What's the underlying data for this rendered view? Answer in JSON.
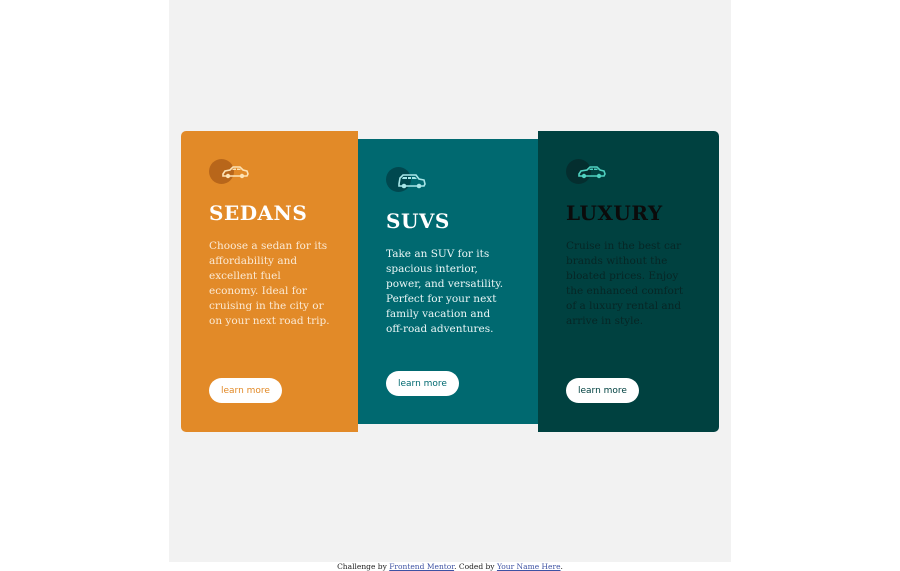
{
  "cards": [
    {
      "title": "SEDANS",
      "text": "Choose a sedan for its affordability and excellent fuel economy. Ideal for cruising in the city or on your next road trip.",
      "button": "learn more",
      "icon": "sedan-car-icon",
      "color": "#e28a28"
    },
    {
      "title": "SUVS",
      "text": "Take an SUV for its spacious interior, power, and versatility. Perfect for your next family vacation and off-road adventures.",
      "button": "learn more",
      "icon": "suv-car-icon",
      "color": "#006970"
    },
    {
      "title": "LUXURY",
      "text": "Cruise in the best car brands without the bloated prices. Enjoy the enhanced comfort of a luxury rental and arrive in style.",
      "button": "learn more",
      "icon": "luxury-car-icon",
      "color": "#004140"
    }
  ],
  "attribution": {
    "prefix": "Challenge by ",
    "link1": "Frontend Mentor",
    "middle": ". Coded by ",
    "link2": "Your Name Here",
    "suffix": "."
  }
}
